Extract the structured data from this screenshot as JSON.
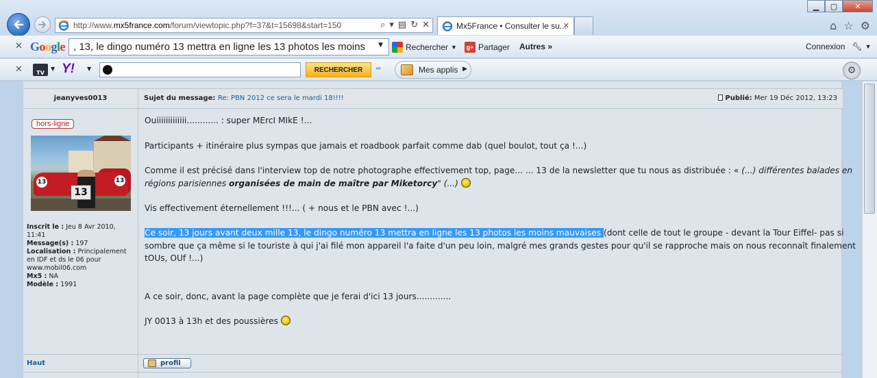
{
  "browser": {
    "url_prefix": "http://www.",
    "url_domain": "mx5france.com",
    "url_path": "/forum/viewtopic.php?f=37&t=15698&start=150",
    "tab_title": "Mx5France • Consulter le su..."
  },
  "google_bar": {
    "search_value": ", 13, le dingo numéro 13 mettra en ligne les 13 photos les moins",
    "rechercher": "Rechercher",
    "partager": "Partager",
    "autres": "Autres »",
    "connexion": "Connexion"
  },
  "yahoo_bar": {
    "tv_label": "TV",
    "logo": "Y!",
    "rechercher": "RECHERCHER",
    "mes_applis": "Mes applis"
  },
  "post": {
    "author": "jeanyves0013",
    "subject_label": "Sujet du message:",
    "subject": "Re: PBN 2012 ce sera le mardi 18!!!!",
    "published_label": "Publié:",
    "published_date": "Mer 19 Déc 2012, 13:23",
    "status": "hors-ligne",
    "profile": {
      "inscrit_label": "Inscrit le :",
      "inscrit_value": "Jeu 8 Avr 2010, 11:41",
      "messages_label": "Message(s) :",
      "messages_value": "197",
      "localisation_label": "Localisation :",
      "localisation_value": "Principalement en IDF et ds le 06 pour www.mobil06.com",
      "mx5_label": "Mx5 :",
      "mx5_value": "NA",
      "modele_label": "Modèle :",
      "modele_value": "1991"
    },
    "body": {
      "p1": "Ouiiiiiiiiiiiii............ : super MErcI MIkE !...",
      "p2": "Participants + itinéraire plus sympas que jamais et roadbook parfait comme dab (quel boulot, tout ça !...)",
      "p3": "Comme il est précisé dans l'interview top de notre photographe effectivement top, page... ... 13 de la newsletter que tu nous as distribuée : «",
      "p3_italic": " (...) différentes balades en",
      "p3b_italic1": "régions parisiennes ",
      "p3b_bold": "organisées de main de maître par Miketorcy",
      "p3b_italic2": "\" (...)",
      "p4": "Vis effectivement éternellement !!!... ( + nous et le PBN avec !...)",
      "p5_highlight": "Ce soir, 13 jours avant deux mille 13, le dingo numéro 13 mettra en ligne les 13 photos les moins mauvaises ",
      "p5_rest": "(dont celle de tout le groupe - devant la Tour Eiffel- pas si",
      "p5b": "sombre que ça même si le touriste à qui j'ai filé mon appareil l'a faite d'un peu loin, malgré mes grands gestes pour qu'il se rapproche mais on nous reconnaît finalement",
      "p5c": "tOUs, OUf !...)",
      "p6": "A ce soir, donc, avant la page complète que je ferai d'ici 13 jours.............",
      "p7": "JY 0013 à 13h et des poussières"
    },
    "avatar_numbers": [
      "13",
      "13",
      "13"
    ],
    "haut": "Haut",
    "profil": "profil"
  },
  "colors": {
    "link": "#1d5a92",
    "highlight": "#3399ff",
    "status_red": "#b01f1f",
    "post_bg": "#dde4ea",
    "page_bg": "#bcd3ea"
  },
  "icons": [
    "back-arrow-icon",
    "forward-arrow-icon",
    "ie-logo-icon",
    "search-icon",
    "refresh-icon",
    "stop-icon",
    "home-icon",
    "star-icon",
    "gear-icon",
    "close-icon",
    "smiley-icon",
    "document-icon"
  ]
}
